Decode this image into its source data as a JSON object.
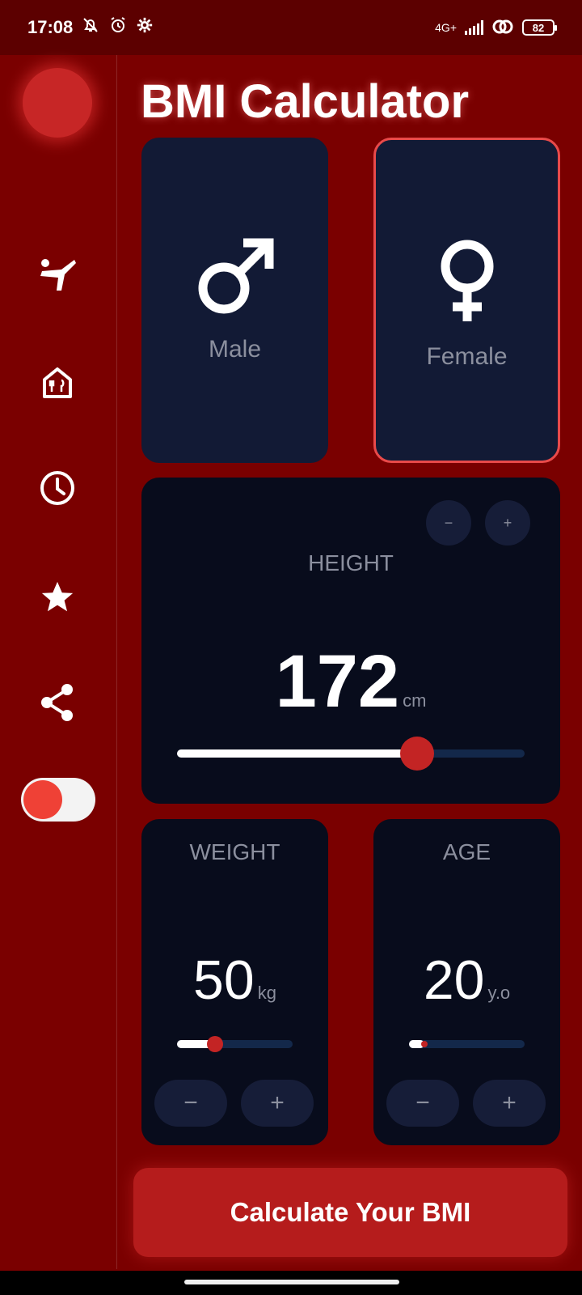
{
  "status_bar": {
    "time": "17:08",
    "network": "4G+",
    "battery": "82",
    "icons": [
      "bell-off-icon",
      "alarm-icon",
      "gear-icon",
      "signal-icon",
      "link-icon",
      "battery-icon"
    ]
  },
  "sidebar": {
    "items": [
      {
        "name": "karate-icon"
      },
      {
        "name": "restaurant-icon"
      },
      {
        "name": "clock-icon"
      },
      {
        "name": "star-icon"
      },
      {
        "name": "share-icon"
      }
    ],
    "toggle_on": true
  },
  "title": "BMI Calculator",
  "gender": {
    "male_label": "Male",
    "female_label": "Female",
    "selected": "female"
  },
  "height": {
    "label": "HEIGHT",
    "value": "172",
    "unit": "cm",
    "minus": "−",
    "plus": "+",
    "slider_fraction": 0.69
  },
  "weight": {
    "label": "WEIGHT",
    "value": "50",
    "unit": "kg",
    "minus": "−",
    "plus": "+",
    "slider_fraction": 0.33
  },
  "age": {
    "label": "AGE",
    "value": "20",
    "unit": "y.o",
    "minus": "−",
    "plus": "+",
    "slider_fraction": 0.13
  },
  "action_button": "Calculate Your BMI",
  "colors": {
    "background": "#7a0000",
    "accent": "#c32424",
    "card": "#080c1c",
    "gender_card": "#121a35",
    "selected_border": "#e94a4a"
  }
}
